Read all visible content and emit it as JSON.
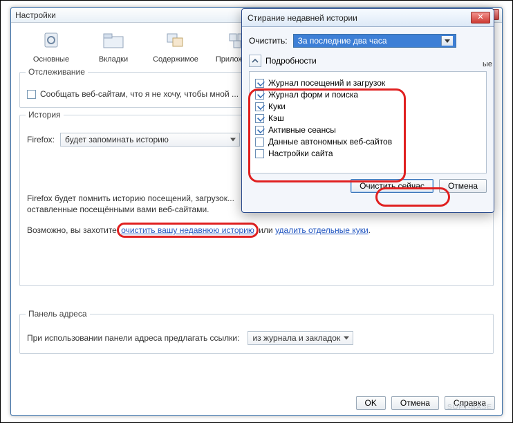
{
  "mainWindow": {
    "title": "Настройки",
    "toolbar": [
      {
        "label": "Основные"
      },
      {
        "label": "Вкладки"
      },
      {
        "label": "Содержимое"
      },
      {
        "label": "Приложения"
      }
    ],
    "toolbarExtra": "ые",
    "tracking": {
      "legend": "Отслеживание",
      "checkboxLabel": "Сообщать веб-сайтам, что я не хочу, чтобы мной ..."
    },
    "history": {
      "legend": "История",
      "firefoxLabel": "Firefox:",
      "modeValue": "будет запоминать историю",
      "descLine1": "Firefox будет помнить историю посещений, загрузок...",
      "descLine2": "оставленные посещёнными вами веб-сайтами.",
      "maybePrefix": "Возможно, вы захотите ",
      "link1": "очистить вашу недавнюю историю",
      "orWord": " или ",
      "link2": "удалить отдельные куки",
      "period": "."
    },
    "addressPanel": {
      "legend": "Панель адреса",
      "label": "При использовании панели адреса предлагать ссылки:",
      "value": "из журнала и закладок"
    },
    "buttons": {
      "ok": "OK",
      "cancel": "Отмена",
      "help": "Справка"
    },
    "watermark": "SOFT-BASE"
  },
  "dialog": {
    "title": "Стирание недавней истории",
    "clearLabel": "Очистить:",
    "comboValue": "За последние два часа",
    "detailsLabel": "Подробности",
    "items": [
      {
        "label": "Журнал посещений и загрузок",
        "checked": true
      },
      {
        "label": "Журнал форм и поиска",
        "checked": true
      },
      {
        "label": "Куки",
        "checked": true
      },
      {
        "label": "Кэш",
        "checked": true
      },
      {
        "label": "Активные сеансы",
        "checked": true
      },
      {
        "label": "Данные автономных веб-сайтов",
        "checked": false
      },
      {
        "label": "Настройки сайта",
        "checked": false
      }
    ],
    "buttons": {
      "clearNow": "Очистить сейчас",
      "cancel": "Отмена"
    }
  }
}
